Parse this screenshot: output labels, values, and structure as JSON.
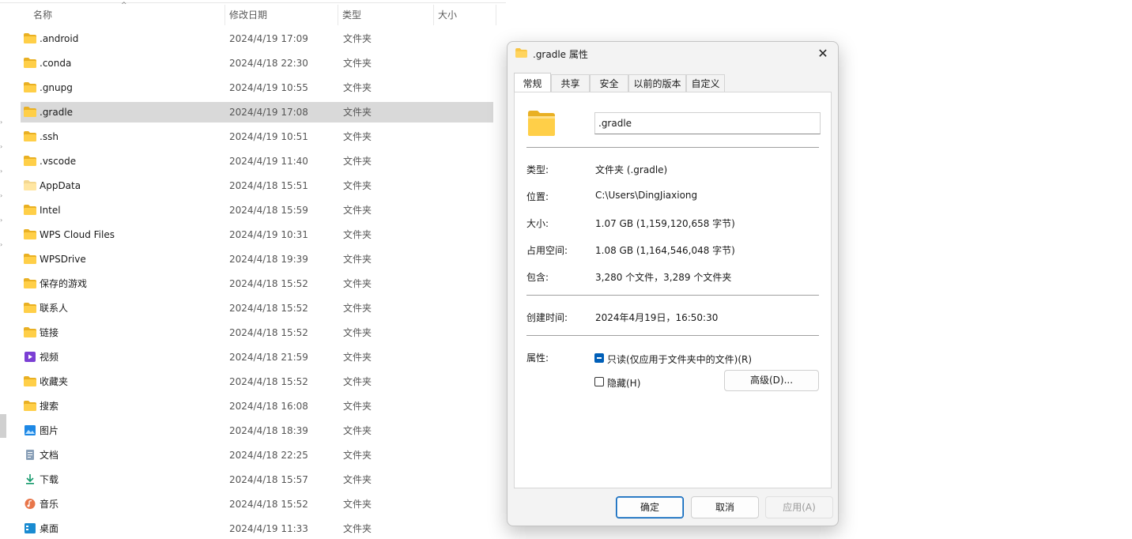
{
  "explorer": {
    "columns": {
      "name": "名称",
      "date": "修改日期",
      "type": "类型",
      "size": "大小"
    },
    "rows": [
      {
        "name": ".android",
        "date": "2024/4/19 17:09",
        "type": "文件夹",
        "icon": "folder-icon"
      },
      {
        "name": ".conda",
        "date": "2024/4/18 22:30",
        "type": "文件夹",
        "icon": "folder-icon"
      },
      {
        "name": ".gnupg",
        "date": "2024/4/19 10:55",
        "type": "文件夹",
        "icon": "folder-icon"
      },
      {
        "name": ".gradle",
        "date": "2024/4/19 17:08",
        "type": "文件夹",
        "icon": "folder-icon",
        "selected": true
      },
      {
        "name": ".ssh",
        "date": "2024/4/19 10:51",
        "type": "文件夹",
        "icon": "folder-icon"
      },
      {
        "name": ".vscode",
        "date": "2024/4/19 11:40",
        "type": "文件夹",
        "icon": "folder-icon"
      },
      {
        "name": "AppData",
        "date": "2024/4/18 15:51",
        "type": "文件夹",
        "icon": "folder-hidden-icon"
      },
      {
        "name": "Intel",
        "date": "2024/4/18 15:59",
        "type": "文件夹",
        "icon": "folder-icon"
      },
      {
        "name": "WPS Cloud Files",
        "date": "2024/4/19 10:31",
        "type": "文件夹",
        "icon": "folder-icon"
      },
      {
        "name": "WPSDrive",
        "date": "2024/4/18 19:39",
        "type": "文件夹",
        "icon": "folder-icon"
      },
      {
        "name": "保存的游戏",
        "date": "2024/4/18 15:52",
        "type": "文件夹",
        "icon": "folder-icon"
      },
      {
        "name": "联系人",
        "date": "2024/4/18 15:52",
        "type": "文件夹",
        "icon": "folder-icon"
      },
      {
        "name": "链接",
        "date": "2024/4/18 15:52",
        "type": "文件夹",
        "icon": "folder-icon"
      },
      {
        "name": "视频",
        "date": "2024/4/18 21:59",
        "type": "文件夹",
        "icon": "videos-icon"
      },
      {
        "name": "收藏夹",
        "date": "2024/4/18 15:52",
        "type": "文件夹",
        "icon": "folder-icon"
      },
      {
        "name": "搜索",
        "date": "2024/4/18 16:08",
        "type": "文件夹",
        "icon": "folder-icon"
      },
      {
        "name": "图片",
        "date": "2024/4/18 18:39",
        "type": "文件夹",
        "icon": "pictures-icon"
      },
      {
        "name": "文档",
        "date": "2024/4/18 22:25",
        "type": "文件夹",
        "icon": "documents-icon"
      },
      {
        "name": "下载",
        "date": "2024/4/18 15:57",
        "type": "文件夹",
        "icon": "downloads-icon"
      },
      {
        "name": "音乐",
        "date": "2024/4/18 15:52",
        "type": "文件夹",
        "icon": "music-icon"
      },
      {
        "name": "桌面",
        "date": "2024/4/19 11:33",
        "type": "文件夹",
        "icon": "desktop-icon"
      }
    ]
  },
  "dialog": {
    "title": ".gradle 属性",
    "tabs": [
      "常规",
      "共享",
      "安全",
      "以前的版本",
      "自定义"
    ],
    "active_tab": 0,
    "folder_name": ".gradle",
    "props": {
      "type_label": "类型:",
      "type_value": "文件夹 (.gradle)",
      "location_label": "位置:",
      "location_value": "C:\\Users\\DingJiaxiong",
      "size_label": "大小:",
      "size_value": "1.07 GB (1,159,120,658 字节)",
      "disk_label": "占用空间:",
      "disk_value": "1.08 GB (1,164,546,048 字节)",
      "contains_label": "包含:",
      "contains_value": "3,280 个文件，3,289 个文件夹",
      "created_label": "创建时间:",
      "created_value": "2024年4月19日，16:50:30",
      "attributes_label": "属性:",
      "readonly_label": "只读(仅应用于文件夹中的文件)(R)",
      "hidden_label": "隐藏(H)",
      "advanced_label": "高级(D)..."
    },
    "buttons": {
      "ok": "确定",
      "cancel": "取消",
      "apply": "应用(A)"
    }
  },
  "colors": {
    "accent": "#005fb8",
    "folder": "#f8c440",
    "selected_row": "#d9d9d9"
  }
}
